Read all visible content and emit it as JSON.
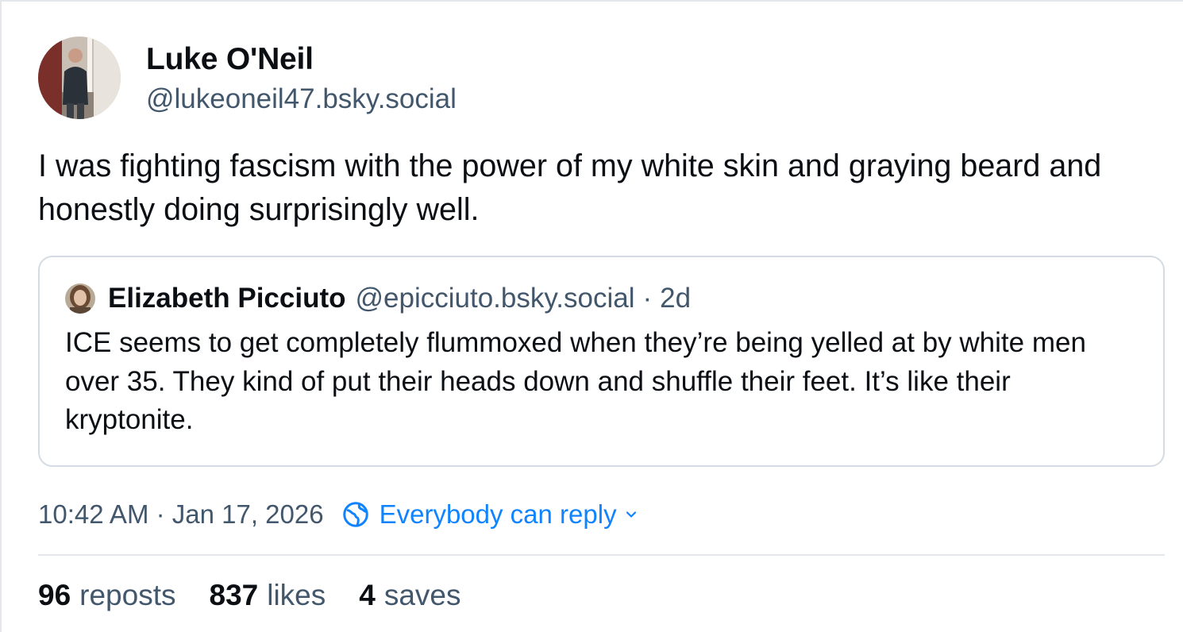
{
  "post": {
    "author": {
      "display_name": "Luke O'Neil",
      "handle": "@lukeoneil47.bsky.social",
      "avatar_icon": "profile-photo"
    },
    "text": "I was fighting fascism with the power of my white skin and graying beard and honestly doing surprisingly well.",
    "quote": {
      "display_name": "Elizabeth Picciuto",
      "handle": "@epicciuto.bsky.social",
      "separator": "·",
      "age": "2d",
      "text": "ICE seems to get completely flummoxed when they’re being yelled at by white men over 35. They kind of put their heads down and shuffle their feet. It’s like their kryptonite.",
      "avatar_icon": "profile-photo"
    },
    "timestamp": "10:42 AM · Jan 17, 2026",
    "reply_setting": {
      "label": "Everybody can reply",
      "icon": "globe-icon",
      "chevron": "chevron-down-icon"
    },
    "stats": {
      "reposts": {
        "count": "96",
        "label": "reposts"
      },
      "likes": {
        "count": "837",
        "label": "likes"
      },
      "saves": {
        "count": "4",
        "label": "saves"
      }
    }
  },
  "colors": {
    "text_primary": "#0b0f14",
    "text_secondary": "#42576c",
    "accent": "#1083fe",
    "border": "#d4dbe2",
    "divider": "#e4e8ec"
  }
}
